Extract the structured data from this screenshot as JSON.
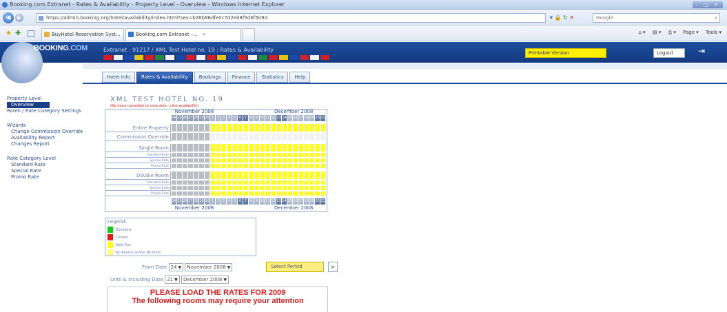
{
  "window": {
    "title": "Booking.com Extranet - Rates & Availability - Property Level - Overview - Windows Internet Explorer",
    "controls": "– □ ×"
  },
  "browser": {
    "url": "https://admin.booking.org/hotel/availability/index.html?ses=b26b86dfe0c7d2ed8f5d6f5b9d",
    "search_placeholder": "Google",
    "tabs": [
      {
        "label": "BuyHotel Reservation Syst..."
      },
      {
        "label": "Booking.com Extranet –..."
      }
    ],
    "commands": [
      "Page ▾",
      "Tools ▾"
    ]
  },
  "site": {
    "brand": "BOOKING",
    "brand_suffix": ".COM",
    "breadcrumb": "Extranet : 91217 / XML Test Hotel no. 19 : Rates & Availability",
    "printable": "Printable Version",
    "logout": "Logout",
    "flag_colors": [
      "#d21f26",
      "#f2f2f2",
      "#1a49a8",
      "#e8c300",
      "#d21f26",
      "#1f8a3a",
      "#f2f2f2",
      "#1a49a8",
      "#d21f26",
      "#f2f2f2",
      "#d21f26",
      "#e8c300",
      "#1a49a8",
      "#d21f26",
      "#f2f2f2",
      "#1f8a3a",
      "#d21f26",
      "#e8c300",
      "#1a49a8",
      "#d21f26",
      "#f2f2f2",
      "#d21f26"
    ]
  },
  "nav_tabs": [
    {
      "label": "Hotel Info",
      "active": false
    },
    {
      "label": "Rates & Availability",
      "active": true
    },
    {
      "label": "Bookings",
      "active": false
    },
    {
      "label": "Finance",
      "active": false
    },
    {
      "label": "Statistics",
      "active": false
    },
    {
      "label": "Help",
      "active": false
    }
  ],
  "sidebar": {
    "property_level": "Property Level",
    "overview": "Overview",
    "room_rate_settings": "Room / Rate Category Settings",
    "wizards": "Wizards",
    "wizard_items": [
      "Change Commission Override",
      "Availability Report",
      "Changes Report"
    ],
    "rate_category_level": "Rate Category Level",
    "rate_items": [
      "Standard Rate",
      "Special Rate",
      "Promo Rate"
    ]
  },
  "hotel": {
    "title": "XML TEST HOTEL NO. 19",
    "subtitle": "(No more (possible) to view data - click availability)"
  },
  "calendar": {
    "month_left": "November 2008",
    "month_right": "December 2008",
    "day_headers": [
      "24",
      "25",
      "26",
      "27",
      "28",
      "29",
      "30",
      "1",
      "2",
      "3",
      "4",
      "5",
      "6",
      "7",
      "8",
      "9",
      "10",
      "11",
      "12",
      "13",
      "14",
      "15",
      "16",
      "17",
      "18",
      "19",
      "20",
      "21"
    ],
    "rows": [
      {
        "label": "Entire Property",
        "size": "big",
        "gap_before": true
      },
      {
        "label": "Commission Override",
        "size": "big",
        "gap_before": false
      },
      {
        "label": "Single Room",
        "size": "big",
        "gap_before": true
      },
      {
        "label": "Standard Rate",
        "size": "small",
        "gap_before": false
      },
      {
        "label": "Special Rate",
        "size": "small",
        "gap_before": false
      },
      {
        "label": "Promo Rate",
        "size": "small",
        "gap_before": false
      },
      {
        "label": "Double Room",
        "size": "big",
        "gap_before": true
      },
      {
        "label": "Standard Rate",
        "size": "small",
        "gap_before": false
      },
      {
        "label": "Special Rate",
        "size": "small",
        "gap_before": false
      },
      {
        "label": "Promo Rate",
        "size": "small",
        "gap_before": false
      }
    ],
    "colors": {
      "past": "#b9bec6",
      "open": "#ffff1a",
      "commission": "#f3f3f3"
    }
  },
  "legend": {
    "title": "Legend:",
    "items": [
      {
        "label": "Bookable",
        "color": "#17c917"
      },
      {
        "label": "Closed",
        "color": "#e01b1b"
      },
      {
        "label": "Sold Out",
        "color": "#ffff1a"
      },
      {
        "label": "No Rooms and/or No Price",
        "color": "#ffff80"
      }
    ]
  },
  "form": {
    "from_label": "From Date",
    "from_day": "24",
    "from_month": "November 2008",
    "until_label": "Until & including Date",
    "until_day": "21",
    "until_month": "December 2008",
    "period_button": "Select Period",
    "go_button": ">"
  },
  "alert": {
    "line1": "PLEASE LOAD THE RATES FOR 2009",
    "line2": "The following rooms may require your attention"
  }
}
